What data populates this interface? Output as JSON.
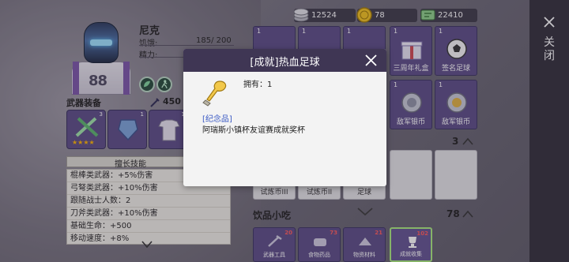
{
  "hero": {
    "name": "尼克",
    "stats": [
      {
        "label": "饥饿:",
        "value": "185/ 200"
      },
      {
        "label": "精力:",
        "value": ""
      }
    ],
    "jersey_number": "88"
  },
  "weapon": {
    "title": "武器装备",
    "power": "450",
    "slots": [
      {
        "count": "3",
        "stars": "★★★★"
      },
      {
        "count": "1",
        "stars": ""
      },
      {
        "count": "1",
        "stars": ""
      }
    ]
  },
  "skills": {
    "tab_label": "擅长技能",
    "items": [
      "棍棒类武器：+5%伤害",
      "弓弩类武器：+10%伤害",
      "跟随战士人数：2",
      "刀斧类武器：+10%伤害",
      "基础生命：+500",
      "移动速度：+8%"
    ]
  },
  "currency": [
    {
      "icon": "coin-stack-icon",
      "value": "12524"
    },
    {
      "icon": "gold-coin-icon",
      "value": "78"
    },
    {
      "icon": "ticket-icon",
      "value": "22410"
    }
  ],
  "grid": {
    "row1": [
      {
        "qty": "1",
        "name": ""
      },
      {
        "qty": "1",
        "name": ""
      },
      {
        "qty": "1",
        "name": ""
      },
      {
        "qty": "1",
        "name": "三周年礼盒"
      },
      {
        "qty": "1",
        "name": "签名足球"
      }
    ],
    "row2": [
      {
        "qty": "1",
        "name": "敌军银币"
      },
      {
        "qty": "1",
        "name": "敌军银币"
      }
    ],
    "row3_count": "3",
    "row3": [
      {
        "qty": "",
        "name": "试炼币III"
      },
      {
        "qty": "",
        "name": "试炼币II"
      },
      {
        "qty": "",
        "name": "[成就]热血足球"
      },
      {
        "qty": "",
        "name": ""
      },
      {
        "qty": "",
        "name": ""
      }
    ]
  },
  "drinks": {
    "title": "饮品小吃",
    "count": "78"
  },
  "categories": [
    {
      "name": "武器工具",
      "badge": "20"
    },
    {
      "name": "食物药品",
      "badge": "73"
    },
    {
      "name": "物资材料",
      "badge": "21"
    },
    {
      "name": "成就收集",
      "badge": "102"
    }
  ],
  "rail": {
    "label": "关闭"
  },
  "modal": {
    "title": "[成就]热血足球",
    "own_label": "拥有：1",
    "tag": "[纪念品]",
    "description": "阿瑞斯小镇杯友谊赛成就奖杯"
  }
}
